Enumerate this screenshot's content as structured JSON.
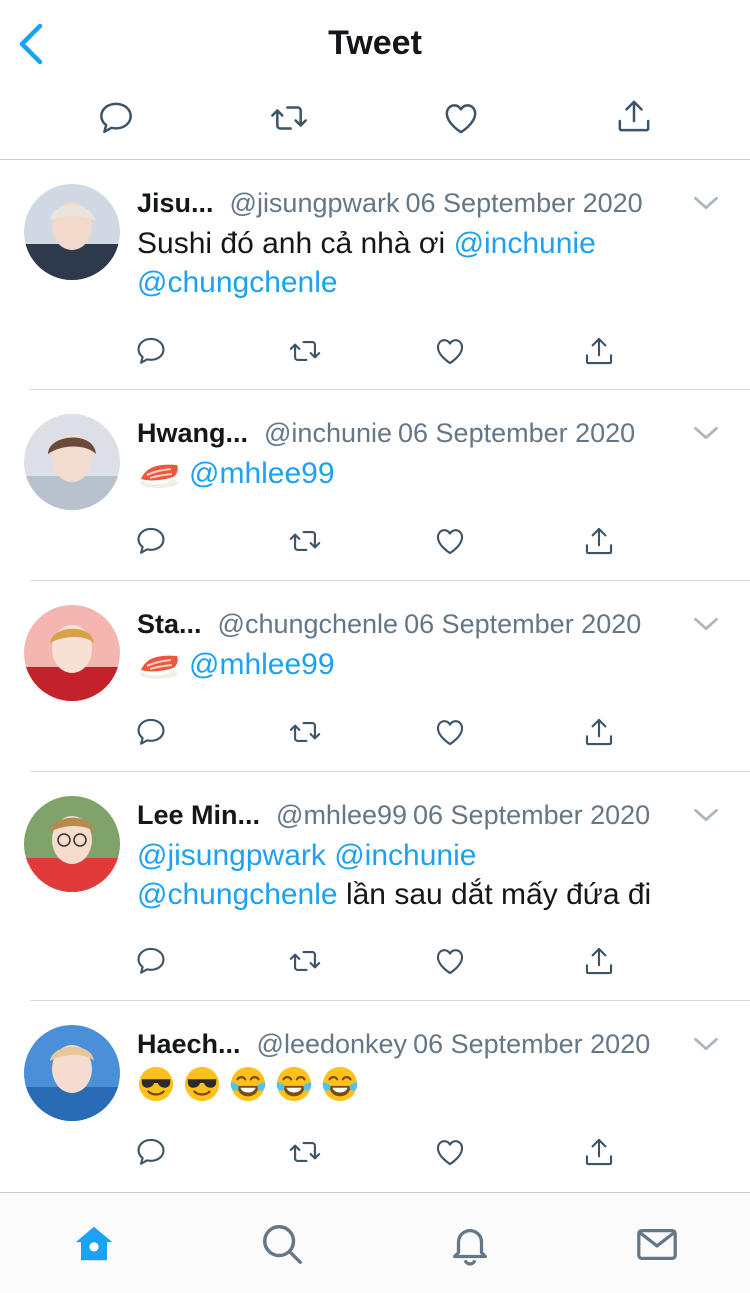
{
  "header": {
    "title": "Tweet"
  },
  "icons": {
    "back": "chevron-left-icon",
    "reply": "reply-icon",
    "retweet": "retweet-icon",
    "like": "heart-icon",
    "share": "share-icon",
    "home": "home-icon",
    "search": "search-icon",
    "notifications": "bell-icon",
    "messages": "mail-icon"
  },
  "colors": {
    "accent": "#1da1f2",
    "text": "#14171a",
    "secondary": "#657786"
  },
  "replies": [
    {
      "name": "Jisu...",
      "handle": "@jisungpwark",
      "date": "06 September 2020",
      "text": {
        "plain": "Sushi đó anh cả nhà ơi ",
        "m1": "@inchunie",
        "m2": "@chungchenle"
      }
    },
    {
      "name": "Hwang...",
      "handle": "@inchunie",
      "date": "06 September 2020",
      "text": {
        "emoji": "sushi",
        "m1": "@mhlee99"
      }
    },
    {
      "name": "Sta...",
      "handle": "@chungchenle",
      "date": "06 September 2020",
      "text": {
        "emoji": "sushi",
        "m1": "@mhlee99"
      }
    },
    {
      "name": "Lee Min...",
      "handle": "@mhlee99",
      "date": "06 September 2020",
      "text": {
        "m1": "@jisungpwark",
        "m2": "@inchunie",
        "m3": "@chungchenle",
        "plain": " lần sau dắt mấy đứa đi"
      }
    },
    {
      "name": "Haech...",
      "handle": "@leedonkey",
      "date": "06 September 2020",
      "text": {
        "emojis": [
          "sunglasses-face",
          "sunglasses-face",
          "tears-of-joy-face",
          "tears-of-joy-face",
          "tears-of-joy-face"
        ]
      }
    }
  ]
}
